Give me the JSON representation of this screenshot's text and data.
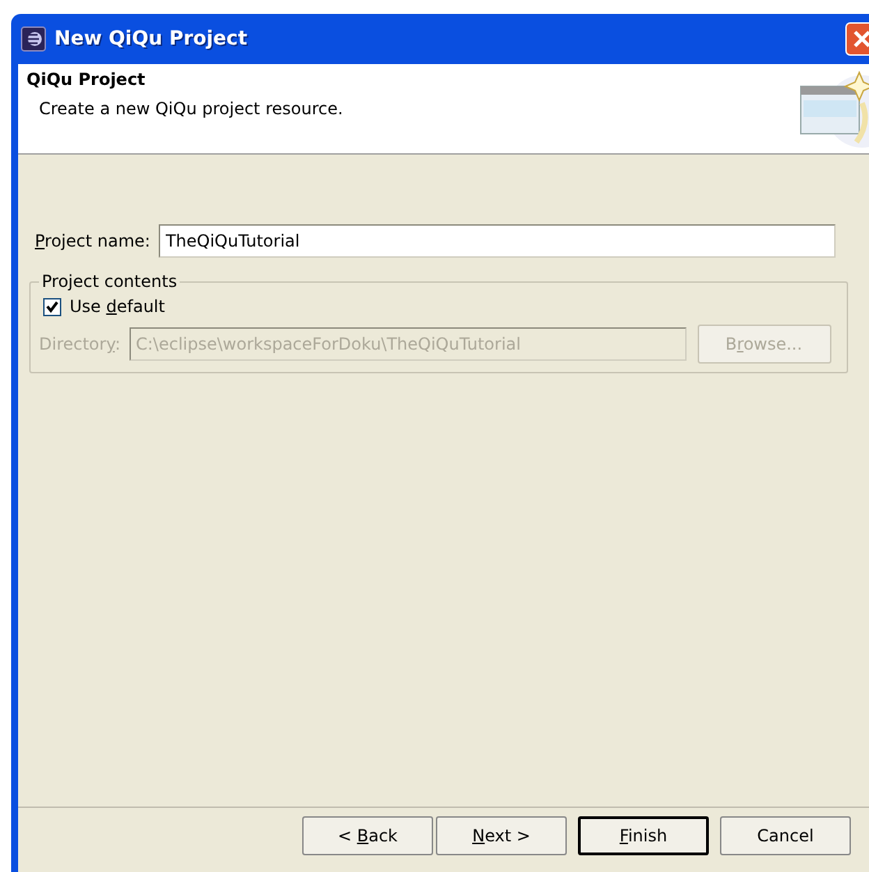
{
  "window": {
    "title": "New QiQu Project"
  },
  "header": {
    "title": "QiQu Project",
    "description": "Create a new QiQu project resource."
  },
  "project_name": {
    "label": [
      {
        "text": "P",
        "mnemonic": true
      },
      {
        "text": "roject name:",
        "mnemonic": false
      }
    ],
    "value": "TheQiQuTutorial"
  },
  "project_contents": {
    "legend": "Project contents",
    "use_default": {
      "label": [
        {
          "text": "Use ",
          "mnemonic": false
        },
        {
          "text": "d",
          "mnemonic": true
        },
        {
          "text": "efault",
          "mnemonic": false
        }
      ],
      "checked": true
    },
    "directory": {
      "label": [
        {
          "text": "Director",
          "mnemonic": false
        },
        {
          "text": "y",
          "mnemonic": true
        },
        {
          "text": ":",
          "mnemonic": false
        }
      ],
      "value": "C:\\eclipse\\workspaceForDoku\\TheQiQuTutorial",
      "disabled": true
    },
    "browse": {
      "label": [
        {
          "text": "B",
          "mnemonic": false
        },
        {
          "text": "r",
          "mnemonic": true
        },
        {
          "text": "owse...",
          "mnemonic": false
        }
      ],
      "disabled": true
    }
  },
  "buttons": [
    {
      "label": [
        {
          "text": "< ",
          "mnemonic": false
        },
        {
          "text": "B",
          "mnemonic": true
        },
        {
          "text": "ack",
          "mnemonic": false
        }
      ],
      "default": false
    },
    {
      "label": [
        {
          "text": "N",
          "mnemonic": true
        },
        {
          "text": "ext >",
          "mnemonic": false
        }
      ],
      "default": false
    },
    {
      "label": [
        {
          "text": "F",
          "mnemonic": true
        },
        {
          "text": "inish",
          "mnemonic": false
        }
      ],
      "default": true
    },
    {
      "label": [
        {
          "text": "Cancel",
          "mnemonic": false
        }
      ],
      "default": false
    }
  ]
}
